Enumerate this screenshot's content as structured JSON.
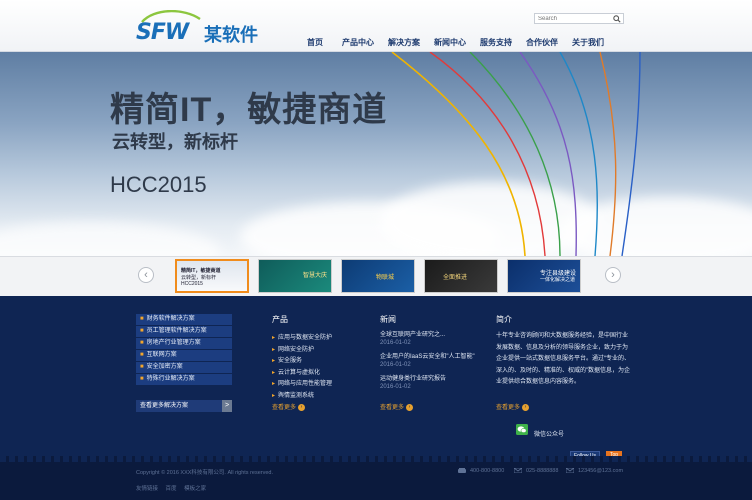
{
  "header": {
    "logo_mark": "SFW",
    "logo_text": "某软件",
    "search_placeholder": "Search",
    "nav": [
      "首页",
      "产品中心",
      "解决方案",
      "新闻中心",
      "服务支持",
      "合作伙伴",
      "关于我们"
    ]
  },
  "banner": {
    "title": "精简IT，敏捷商道",
    "subtitle": "云转型，新标杆",
    "event": "HCC2015"
  },
  "thumbnails": [
    {
      "lines": [
        "精简IT，敏捷商道",
        "云转型，新标杆",
        "HCC2015"
      ]
    },
    {
      "lines": [
        "智慧大庆"
      ]
    },
    {
      "lines": [
        "物联城"
      ]
    },
    {
      "lines": [
        "全面推进"
      ]
    },
    {
      "lines": [
        "专注县级建设",
        "一体化解决之道"
      ]
    }
  ],
  "solutions": {
    "items": [
      "财务软件解决方案",
      "员工管理软件解决方案",
      "房地产行业管理方案",
      "互联网方案",
      "安全加密方案",
      "特殊行业解决方案"
    ],
    "more_label": "查看更多解决方案",
    "more_arrow": ">"
  },
  "products": {
    "title": "产品",
    "items": [
      "应用与数据安全防护",
      "网络安全防护",
      "安全服务",
      "云计算与虚拟化",
      "网络与应用性能管理",
      "舆情监测系统"
    ],
    "more": "查看更多"
  },
  "news": {
    "title": "新闻",
    "items": [
      {
        "title": "全球互联网产业研究之...",
        "date": "2016-01-02"
      },
      {
        "title": "企业用户的IaaS云安全和\"人工智能\"",
        "date": "2016-01-02"
      },
      {
        "title": "运动健身类行业研究报告",
        "date": "2016-01-02"
      }
    ],
    "more": "查看更多"
  },
  "intro": {
    "title": "简介",
    "text": "十年专业咨询顾问和大数据服务经验，是中国行业发展数据、信息及分析的领导服务企业，致力于为企业提供一站式数据信息服务平台。通过“专业的、深入的、及时的、精准的、权威的”数据信息，为企业提供综合数据信息内容服务。",
    "more": "查看更多"
  },
  "wechat": {
    "label": "微信公众号"
  },
  "bottom": {
    "follow": "Follow Us",
    "top": "Top",
    "copyright": "Copyright © 2016 XXX科技有限公司. All rights reserved.",
    "links": [
      "友情链接",
      "百度",
      "模板之家"
    ],
    "phone": "400-800-8800",
    "tel": "025-8888888",
    "email": "123456@123.com"
  },
  "colors": {
    "accent": "#f2a62c",
    "navy": "#0f2553",
    "brand": "#1a6fb8"
  }
}
